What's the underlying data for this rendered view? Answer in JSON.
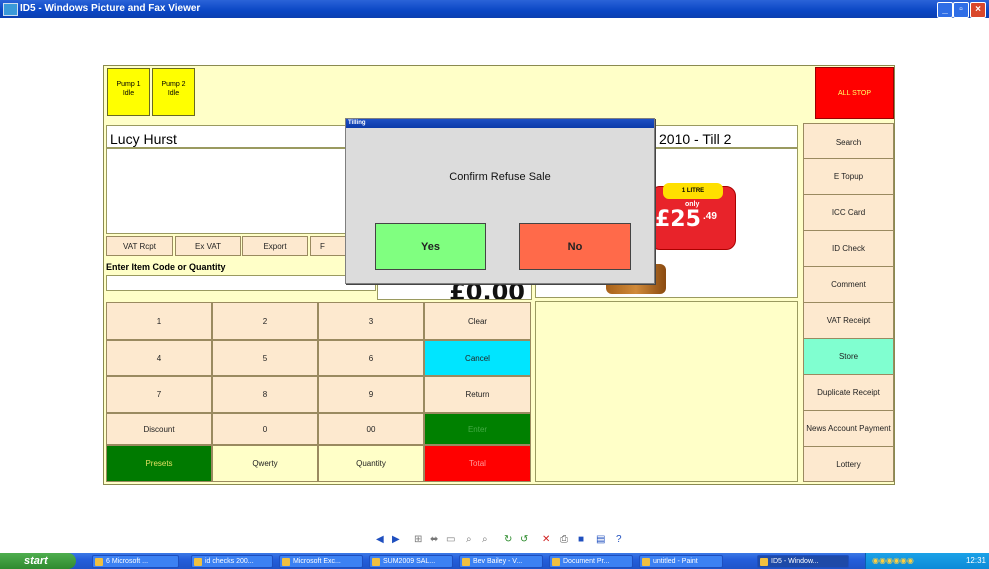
{
  "window": {
    "title": "ID5 - Windows Picture and Fax Viewer"
  },
  "pumps": [
    {
      "line1": "Pump 1",
      "line2": "Idle"
    },
    {
      "line1": "Pump 2",
      "line2": "Idle"
    }
  ],
  "all_stop": "ALL STOP",
  "operator": "Lucy Hurst",
  "header_right": "2010 - Till 2",
  "receipt_buttons": [
    "VAT Rcpt",
    "Ex VAT",
    "Export",
    "F"
  ],
  "entry_label": "Enter Item Code or Quantity",
  "total_display": "£0.00",
  "promo": {
    "size": "1 LITRE",
    "only": "only",
    "price": "£25",
    "pence": ".49"
  },
  "keypad": [
    [
      "1",
      "2",
      "3",
      "Clear"
    ],
    [
      "4",
      "5",
      "6",
      "Cancel"
    ],
    [
      "7",
      "8",
      "9",
      "Return"
    ],
    [
      "Discount",
      "0",
      "00",
      "Enter"
    ],
    [
      "Presets",
      "Qwerty",
      "Quantity",
      "Total"
    ]
  ],
  "side_buttons": [
    "Search",
    "E Topup",
    "ICC Card",
    "ID Check",
    "Comment",
    "VAT Receipt",
    "Store",
    "Duplicate Receipt",
    "News Account Payment",
    "Lottery"
  ],
  "dialog": {
    "title": "Tilling",
    "message": "Confirm Refuse Sale",
    "yes": "Yes",
    "no": "No"
  },
  "taskbar": {
    "start": "start",
    "tasks": [
      "6 Microsoft ...",
      "id checks 200...",
      "Microsoft Exc...",
      "SUM2009 SAL...",
      "Bev Bailey - V...",
      "Document Pr...",
      "untitled - Paint",
      "ID5 - Window..."
    ],
    "clock": "12:31"
  },
  "colors": {
    "pump": "#ffff00",
    "all_stop": "#ff0000",
    "cancel": "#00e5ff",
    "enter": "#008000",
    "presets": "#007a00",
    "total": "#ff0000",
    "store": "#80ffd0",
    "yes": "#80ff80",
    "no": "#ff6a4a"
  }
}
